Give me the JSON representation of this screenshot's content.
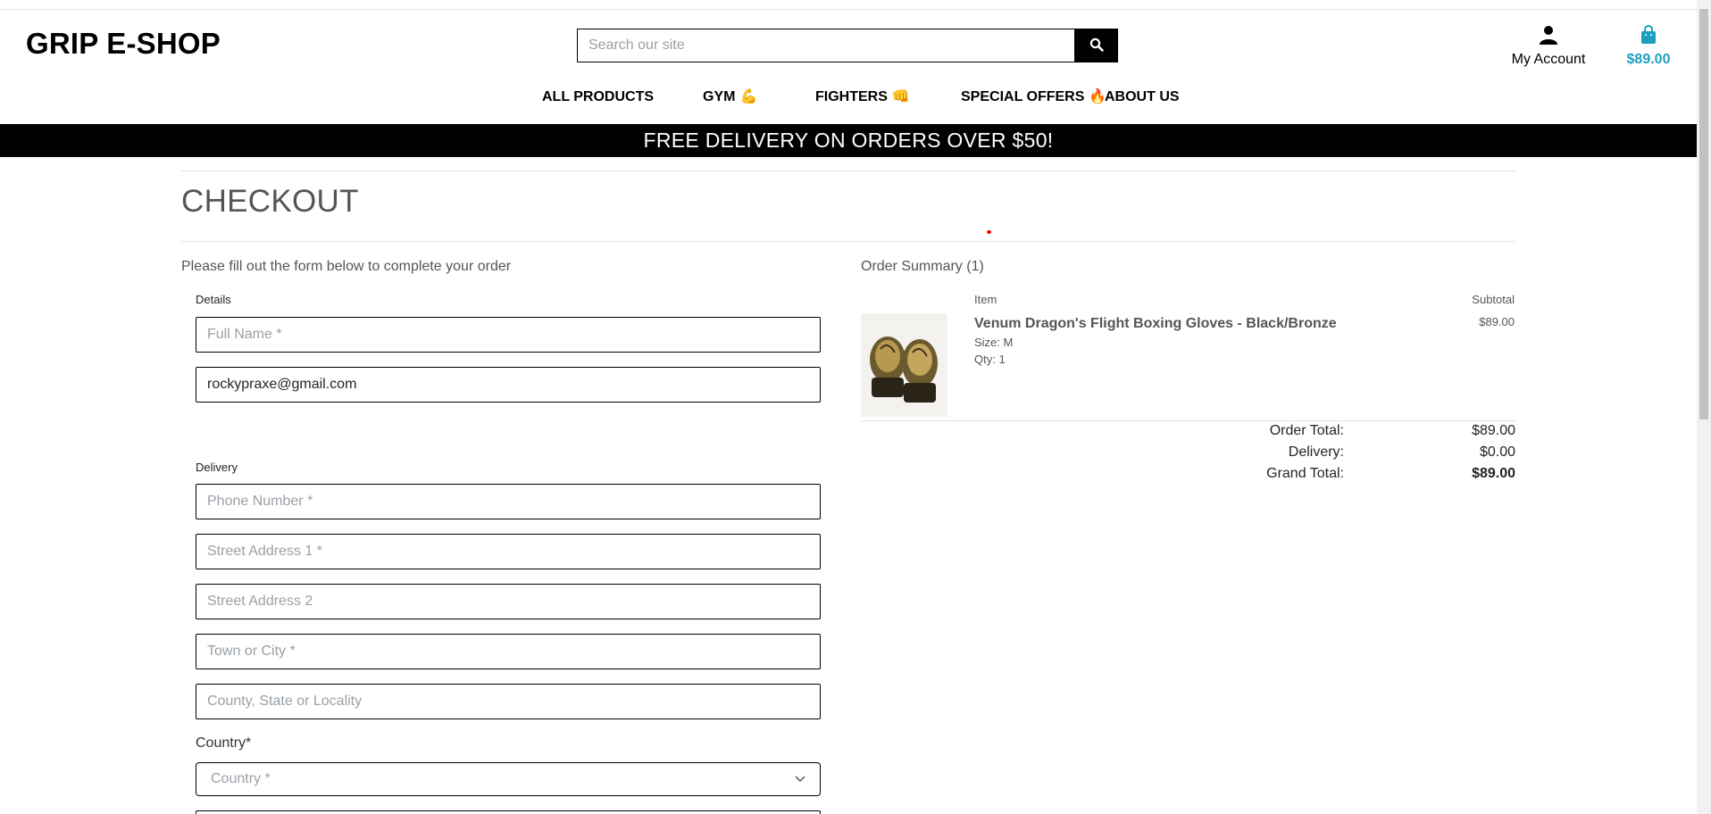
{
  "header": {
    "logo": "GRIP E-SHOP",
    "search_placeholder": "Search our site",
    "account_label": "My Account",
    "bag_total": "$89.00"
  },
  "nav": {
    "items": [
      {
        "label": "ALL PRODUCTS",
        "emoji": ""
      },
      {
        "label": "GYM",
        "emoji": "💪"
      },
      {
        "label": "FIGHTERS",
        "emoji": "👊"
      },
      {
        "label": "SPECIAL OFFERS",
        "emoji": "🔥"
      },
      {
        "label": "ABOUT US",
        "emoji": ""
      }
    ]
  },
  "banner": "FREE DELIVERY ON ORDERS OVER $50!",
  "checkout": {
    "title": "CHECKOUT",
    "intro": "Please fill out the form below to complete your order",
    "details_label": "Details",
    "full_name_placeholder": "Full Name *",
    "email_value": "rockypraxe@gmail.com",
    "delivery_label": "Delivery",
    "phone_placeholder": "Phone Number *",
    "street1_placeholder": "Street Address 1 *",
    "street2_placeholder": "Street Address 2",
    "town_placeholder": "Town or City *",
    "county_placeholder": "County, State or Locality",
    "country_label": "Country*",
    "country_selected": "Country *"
  },
  "summary": {
    "title": "Order Summary (1)",
    "col_item": "Item",
    "col_subtotal": "Subtotal",
    "product": {
      "name": "Venum Dragon's Flight Boxing Gloves - Black/Bronze",
      "size": "Size: M",
      "qty": "Qty: 1",
      "subtotal": "$89.00"
    },
    "order_total_label": "Order Total:",
    "order_total": "$89.00",
    "delivery_label": "Delivery:",
    "delivery": "$0.00",
    "grand_total_label": "Grand Total:",
    "grand_total": "$89.00"
  },
  "colors": {
    "accent": "#1b9fbf",
    "banner_bg": "#000000"
  }
}
